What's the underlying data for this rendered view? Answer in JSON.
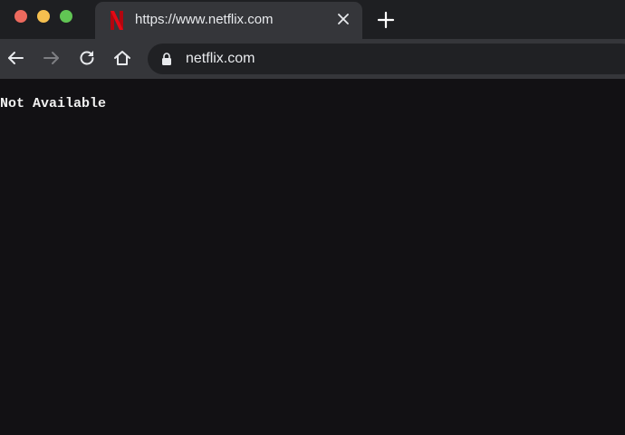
{
  "window": {
    "controls": [
      "close",
      "minimize",
      "maximize"
    ],
    "colors": {
      "close": "#ed6a5e",
      "minimize": "#f5bf4f",
      "maximize": "#61c554"
    }
  },
  "tab": {
    "favicon": "netflix-icon",
    "title": "https://www.netflix.com",
    "close_icon": "close-icon"
  },
  "new_tab_icon": "plus-icon",
  "toolbar": {
    "back_icon": "arrow-left-icon",
    "forward_icon": "arrow-right-icon",
    "reload_icon": "reload-icon",
    "home_icon": "home-icon"
  },
  "omnibox": {
    "lock_icon": "lock-icon",
    "url": "netflix.com"
  },
  "page": {
    "message": "Not Available"
  },
  "colors": {
    "brand_red": "#e50914",
    "page_background": "#121114"
  }
}
